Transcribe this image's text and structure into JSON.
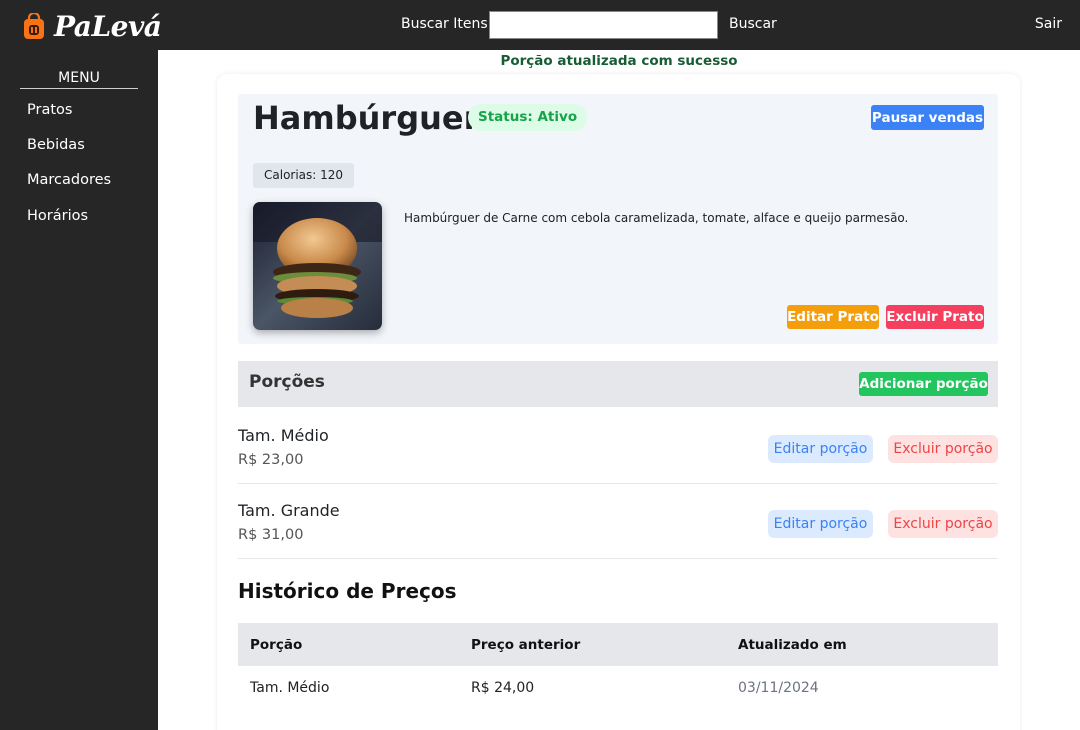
{
  "app": {
    "brand": "PaLevá",
    "logo_icon": "shopping-bag-icon",
    "accent": "#262627"
  },
  "header": {
    "search_label": "Buscar Itens",
    "search_value": "",
    "search_button": "Buscar",
    "logout": "Sair"
  },
  "sidebar": {
    "title": "MENU",
    "items": [
      {
        "label": "Pratos"
      },
      {
        "label": "Bebidas"
      },
      {
        "label": "Marcadores"
      },
      {
        "label": "Horários"
      }
    ]
  },
  "flash": "Porção atualizada com sucesso",
  "dish": {
    "name": "Hambúrguer",
    "status": "Status: Ativo",
    "pause_button": "Pausar vendas",
    "calories": "Calorias: 120",
    "description": "Hambúrguer de Carne com cebola caramelizada, tomate, alface e queijo parmesão.",
    "edit_button": "Editar Prato",
    "delete_button": "Excluir Prato"
  },
  "portions": {
    "title": "Porções",
    "add_button": "Adicionar porção",
    "items": [
      {
        "name": "Tam. Médio",
        "price": "R$ 23,00",
        "edit": "Editar porção",
        "delete": "Excluir porção"
      },
      {
        "name": "Tam. Grande",
        "price": "R$ 31,00",
        "edit": "Editar porção",
        "delete": "Excluir porção"
      }
    ]
  },
  "history": {
    "title": "Histórico de Preços",
    "columns": [
      "Porção",
      "Preço anterior",
      "Atualizado em"
    ],
    "rows": [
      [
        "Tam. Médio",
        "R$ 24,00",
        "03/11/2024"
      ]
    ]
  },
  "colors": {
    "pause": "#3b82f6",
    "edit_dish": "#f59e0b",
    "delete_dish": "#f43f5e",
    "add_portion": "#22c55e",
    "status_text": "#16a34a"
  }
}
